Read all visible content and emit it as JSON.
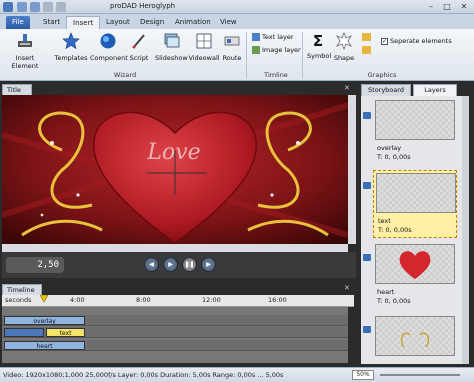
{
  "window": {
    "title": "proDAD Heroglyph"
  },
  "ribbon": {
    "tabs": [
      {
        "label": "File"
      },
      {
        "label": "Start"
      },
      {
        "label": "Insert"
      },
      {
        "label": "Layout"
      },
      {
        "label": "Design"
      },
      {
        "label": "Animation"
      },
      {
        "label": "View"
      }
    ],
    "active_tab": "Insert",
    "wizard": {
      "buttons": [
        {
          "label": "Insert Element",
          "icon": "brush-icon"
        },
        {
          "label": "Templates",
          "icon": "star-icon"
        },
        {
          "label": "Component",
          "icon": "globe-icon"
        },
        {
          "label": "Script",
          "icon": "pen-icon"
        },
        {
          "label": "Slideshow",
          "icon": "slideshow-icon"
        },
        {
          "label": "Videowall",
          "icon": "videowall-icon"
        },
        {
          "label": "Route",
          "icon": "route-icon"
        }
      ],
      "group_label": "Wizard"
    },
    "timeline": {
      "items": [
        {
          "label": "Text layer",
          "icon": "text-layer-icon"
        },
        {
          "label": "Image layer",
          "icon": "image-layer-icon"
        }
      ],
      "group_label": "Timline"
    },
    "graphics": {
      "buttons": [
        {
          "label": "Symbol",
          "icon": "sigma-icon"
        },
        {
          "label": "Shape",
          "icon": "shape-icon"
        }
      ],
      "checkbox_label": "Seperate elements",
      "checkbox_checked": true,
      "group_label": "Graphics"
    }
  },
  "preview_panel": {
    "tab_label": "Title",
    "overlay_text": "Love",
    "timecode": "2,50"
  },
  "timeline_panel": {
    "tab_label": "Timeline",
    "ruler_unit": "seconds",
    "ticks": [
      "4:00",
      "8:00",
      "12:00",
      "16:00"
    ],
    "tracks": [
      {
        "name": "overlay"
      },
      {
        "name": "text"
      },
      {
        "name": "heart"
      }
    ]
  },
  "side_panel": {
    "tabs": [
      {
        "label": "Storyboard"
      },
      {
        "label": "Layers"
      }
    ],
    "active_tab": "Layers",
    "layers": [
      {
        "name": "overlay",
        "time": "T: 0, 0,00s",
        "selected": false
      },
      {
        "name": "text",
        "time": "T: 0, 0,00s",
        "selected": true
      },
      {
        "name": "heart",
        "time": "T: 0, 0,00s",
        "selected": false
      }
    ]
  },
  "statusbar": {
    "text": "Video: 1920x1080;1,000  25,000f/s  Layer: 0,00s  Duration: 5,00s  Range: 0,00s ... 5,00s",
    "zoom": "50%"
  },
  "colors": {
    "ribbon_bg": "#e9eef4",
    "file_tab": "#2b5aa6",
    "selected_layer": "#fff0a6",
    "timeline_text_clip": "#f2e36a",
    "timeline_track_clip": "#8fb4e0"
  }
}
